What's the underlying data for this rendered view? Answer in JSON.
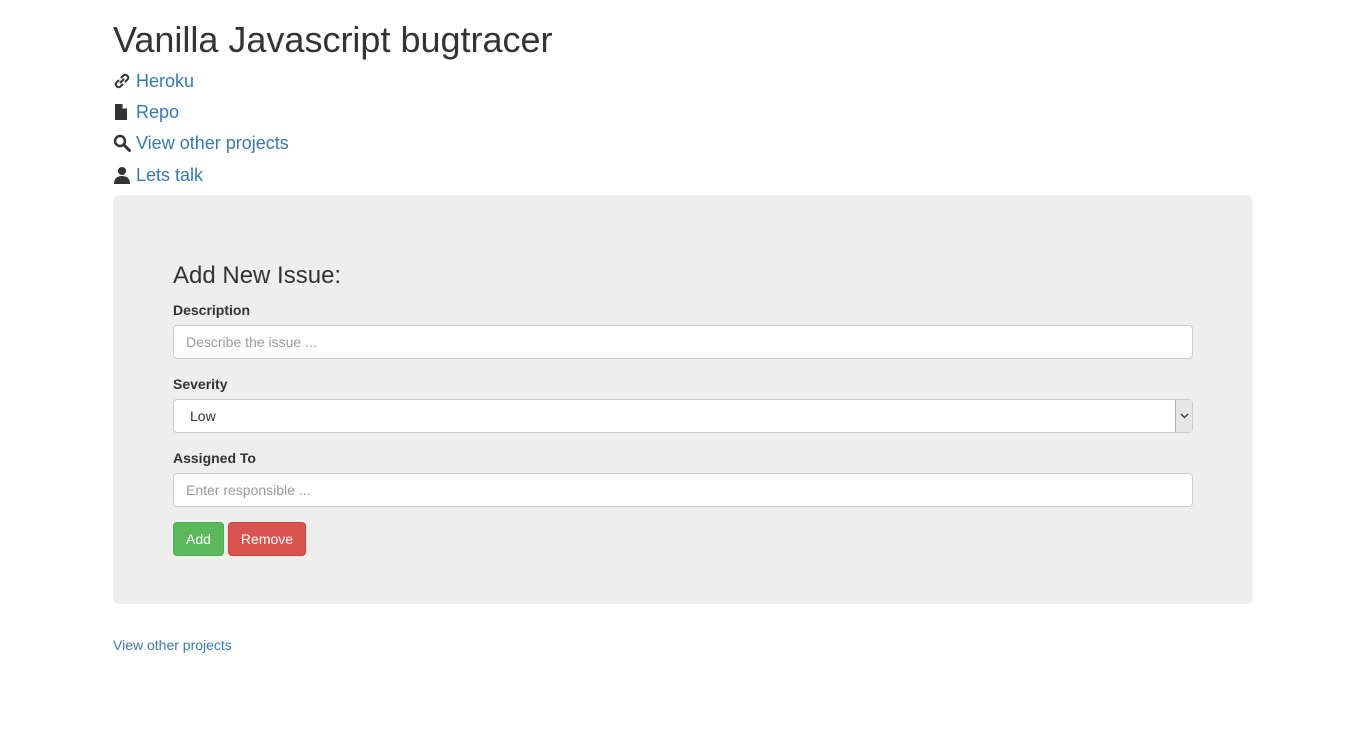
{
  "header": {
    "title": "Vanilla Javascript bugtracer"
  },
  "links": [
    {
      "label": "Heroku",
      "icon": "link-icon"
    },
    {
      "label": "Repo",
      "icon": "file-icon"
    },
    {
      "label": "View other projects",
      "icon": "search-icon"
    },
    {
      "label": "Lets talk",
      "icon": "user-icon"
    }
  ],
  "form": {
    "title": "Add New Issue:",
    "description_label": "Description",
    "description_placeholder": "Describe the issue ...",
    "description_value": "",
    "severity_label": "Severity",
    "severity_selected": "Low",
    "assigned_label": "Assigned To",
    "assigned_placeholder": "Enter responsible ...",
    "assigned_value": "",
    "add_label": "Add",
    "remove_label": "Remove"
  },
  "footer": {
    "link_label": "View other projects"
  },
  "colors": {
    "link": "#337ab7",
    "panel_bg": "#eeeeee",
    "add_button": "#5cb85c",
    "remove_button": "#d9534f"
  }
}
